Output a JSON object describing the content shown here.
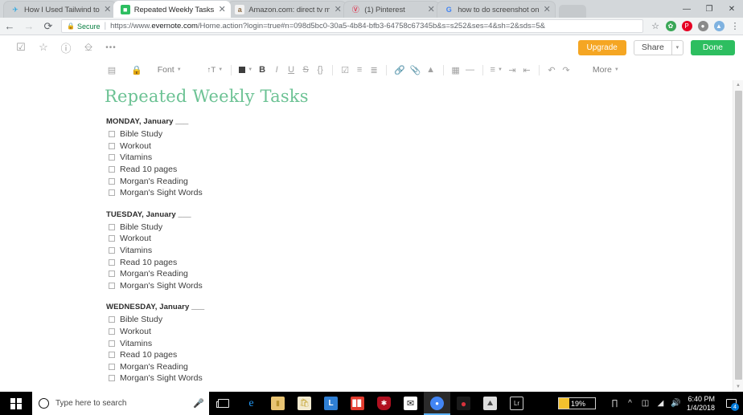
{
  "browser": {
    "tabs": [
      {
        "title": "How I Used Tailwind to ",
        "favicon": "tailwind-icon",
        "active": false
      },
      {
        "title": "Repeated Weekly Tasks ",
        "favicon": "evernote-icon",
        "active": true
      },
      {
        "title": "Amazon.com: direct tv m",
        "favicon": "amazon-icon",
        "active": false
      },
      {
        "title": "(1) Pinterest",
        "favicon": "pinterest-icon",
        "active": false
      },
      {
        "title": "how to do screenshot on",
        "favicon": "google-icon",
        "active": false
      }
    ],
    "window_controls": {
      "minimize": "—",
      "maximize": "❐",
      "close": "✕"
    },
    "nav": {
      "back": "←",
      "forward": "→",
      "reload": "⟳"
    },
    "omnibox": {
      "lock_label": "Secure",
      "url_scheme": "https://www.",
      "url_host": "evernote.com",
      "url_path": "/Home.action?login=true#n=098d5bc0-30a5-4b84-bfb3-64758c67345b&s=s252&ses=4&sh=2&sds=5&",
      "bookmark_star": "☆"
    },
    "extensions": [
      {
        "name": "color-wheel-extension",
        "glyph": "✿",
        "color": "#3aa757"
      },
      {
        "name": "pinterest-extension",
        "glyph": "P",
        "color": "#e60023"
      },
      {
        "name": "evernote-web-clipper-extension",
        "glyph": "●",
        "color": "#8a8a8a"
      },
      {
        "name": "blue-extension",
        "glyph": "▲",
        "color": "#6fa8dc"
      }
    ],
    "chrome_menu": "⋮"
  },
  "evernote": {
    "note_tools": [
      {
        "name": "task-icon",
        "glyph": "☑"
      },
      {
        "name": "favorite-star-icon",
        "glyph": "☆"
      },
      {
        "name": "info-icon",
        "glyph": "ⓘ"
      },
      {
        "name": "trash-icon",
        "glyph": "Ὕ1"
      },
      {
        "name": "more-options-icon",
        "glyph": "•••"
      }
    ],
    "actions": {
      "upgrade_label": "Upgrade",
      "share_label": "Share",
      "share_caret": "▾",
      "done_label": "Done"
    },
    "format_toolbar": {
      "font_label": "Font",
      "size_label": "↑T",
      "more_label": "More",
      "buttons": [
        {
          "name": "sidebar-toggle-icon",
          "glyph": "▤"
        },
        {
          "name": "lock-icon",
          "glyph": "ὑ2"
        },
        {
          "name": "text-color-icon",
          "glyph": "■"
        },
        {
          "name": "bold-icon",
          "glyph": "B"
        },
        {
          "name": "italic-icon",
          "glyph": "I"
        },
        {
          "name": "underline-icon",
          "glyph": "U"
        },
        {
          "name": "strikethrough-icon",
          "glyph": "S"
        },
        {
          "name": "code-icon",
          "glyph": "{}"
        },
        {
          "name": "checkbox-icon",
          "glyph": "☑"
        },
        {
          "name": "bulleted-list-icon",
          "glyph": "☰"
        },
        {
          "name": "numbered-list-icon",
          "glyph": "☷"
        },
        {
          "name": "link-icon",
          "glyph": "ὑ7"
        },
        {
          "name": "attachment-icon",
          "glyph": "Ὄe"
        },
        {
          "name": "highlight-icon",
          "glyph": "△"
        },
        {
          "name": "table-icon",
          "glyph": "▦"
        },
        {
          "name": "horizontal-rule-icon",
          "glyph": "—"
        },
        {
          "name": "align-icon",
          "glyph": "≡"
        },
        {
          "name": "indent-increase-icon",
          "glyph": "⇥"
        },
        {
          "name": "indent-decrease-icon",
          "glyph": "⇤"
        },
        {
          "name": "undo-icon",
          "glyph": "↶"
        },
        {
          "name": "redo-icon",
          "glyph": "↷"
        }
      ]
    },
    "note": {
      "title": "Repeated Weekly Tasks",
      "days": [
        {
          "heading": "MONDAY, January ___",
          "tasks": [
            "Bible Study",
            "Workout",
            "Vitamins",
            "Read 10 pages",
            "Morgan's Reading",
            "Morgan's Sight Words"
          ]
        },
        {
          "heading": "TUESDAY, January ___",
          "tasks": [
            "Bible Study",
            "Workout",
            "Vitamins",
            "Read 10 pages",
            "Morgan's Reading",
            "Morgan's Sight Words"
          ]
        },
        {
          "heading": "WEDNESDAY, January ___",
          "tasks": [
            "Bible Study",
            "Workout",
            "Vitamins",
            "Read 10 pages",
            "Morgan's Reading",
            "Morgan's Sight Words"
          ]
        }
      ]
    },
    "accent_green": "#2dbe60",
    "title_green": "#6cc294",
    "upgrade_orange": "#f5a623"
  },
  "taskbar": {
    "start_label": "start-button",
    "search_placeholder": "Type here to search",
    "mic_glyph": "Ἲ4",
    "apps": [
      {
        "name": "taskbar-edge",
        "glyph": "e",
        "bg": "#0b3c6e",
        "fg": "#2196f3",
        "active": false
      },
      {
        "name": "taskbar-file-explorer",
        "glyph": "Ὄ1",
        "bg": "#e8c170",
        "fg": "#f5d78e",
        "active": false
      },
      {
        "name": "taskbar-microsoft-store",
        "glyph": "Ὤd",
        "bg": "#f0e6c8",
        "fg": "#d4b14a",
        "active": false
      },
      {
        "name": "taskbar-blue-l-app",
        "glyph": "L",
        "bg": "#2f7fd4",
        "fg": "#ffffff",
        "active": false
      },
      {
        "name": "taskbar-red-app",
        "glyph": "▐▐",
        "bg": "#e23b2e",
        "fg": "#ffffff",
        "active": false
      },
      {
        "name": "taskbar-security-shield",
        "glyph": "Ὦ1",
        "bg": "#b01020",
        "fg": "#ffffff",
        "active": false
      },
      {
        "name": "taskbar-mail",
        "glyph": "✉",
        "bg": "#ffffff",
        "fg": "#1a1a1a",
        "active": false
      },
      {
        "name": "taskbar-chrome",
        "glyph": "●",
        "bg": "#ffffff",
        "fg": "#4285f4",
        "active": true
      },
      {
        "name": "taskbar-opera",
        "glyph": "O",
        "bg": "#1a1a1a",
        "fg": "#d8323c",
        "active": false
      },
      {
        "name": "taskbar-photos",
        "glyph": "Ὓb",
        "bg": "#e6e6e6",
        "fg": "#4a4a4a",
        "active": false
      },
      {
        "name": "taskbar-lr-app",
        "glyph": "Lr",
        "bg": "#1a1a1a",
        "fg": "#d8d8d8",
        "active": false
      }
    ],
    "battery_percent": "19%",
    "tray_icons": [
      {
        "name": "network-share-icon",
        "glyph": "⎇"
      },
      {
        "name": "show-hidden-icons-chevron",
        "glyph": "∧"
      },
      {
        "name": "battery-tray-icon",
        "glyph": "ὐb"
      },
      {
        "name": "wifi-icon",
        "glyph": "◢"
      },
      {
        "name": "volume-icon",
        "glyph": "ὐa"
      }
    ],
    "clock_time": "6:40 PM",
    "clock_date": "1/4/2018",
    "action_center_badge": "4"
  }
}
